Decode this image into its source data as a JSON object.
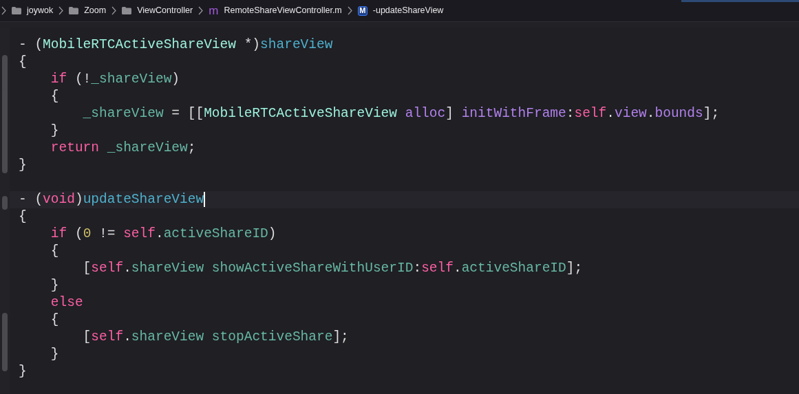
{
  "breadcrumb": [
    {
      "kind": "folder",
      "label": "joywok"
    },
    {
      "kind": "folder",
      "label": "Zoom"
    },
    {
      "kind": "folder",
      "label": "ViewController"
    },
    {
      "kind": "source-file",
      "glyph": "m",
      "label": "RemoteShareViewController.m"
    },
    {
      "kind": "method",
      "glyph": "M",
      "label": "-updateShareView"
    }
  ],
  "lines": [
    {
      "current": false,
      "tokens": [
        {
          "kind": "plain",
          "t": "- ("
        },
        {
          "kind": "type",
          "t": "MobileRTCActiveShareView"
        },
        {
          "kind": "plain",
          "t": " *)"
        },
        {
          "kind": "decl",
          "t": "shareView"
        }
      ]
    },
    {
      "current": false,
      "tokens": [
        {
          "kind": "plain",
          "t": "{"
        }
      ]
    },
    {
      "current": false,
      "tokens": [
        {
          "kind": "keyword",
          "t": "    if"
        },
        {
          "kind": "plain",
          "t": " (!"
        },
        {
          "kind": "ivar",
          "t": "_shareView"
        },
        {
          "kind": "plain",
          "t": ")"
        }
      ]
    },
    {
      "current": false,
      "tokens": [
        {
          "kind": "plain",
          "t": "    {"
        }
      ]
    },
    {
      "current": false,
      "tokens": [
        {
          "kind": "ivar",
          "t": "        _shareView"
        },
        {
          "kind": "plain",
          "t": " = [["
        },
        {
          "kind": "type",
          "t": "MobileRTCActiveShareView"
        },
        {
          "kind": "sdk",
          "t": " alloc"
        },
        {
          "kind": "plain",
          "t": "] "
        },
        {
          "kind": "sdk",
          "t": "initWithFrame"
        },
        {
          "kind": "plain",
          "t": ":"
        },
        {
          "kind": "keyword",
          "t": "self"
        },
        {
          "kind": "plain",
          "t": "."
        },
        {
          "kind": "sdk",
          "t": "view"
        },
        {
          "kind": "plain",
          "t": "."
        },
        {
          "kind": "sdk",
          "t": "bounds"
        },
        {
          "kind": "plain",
          "t": "];"
        }
      ]
    },
    {
      "current": false,
      "tokens": [
        {
          "kind": "plain",
          "t": "    }"
        }
      ]
    },
    {
      "current": false,
      "tokens": [
        {
          "kind": "keyword",
          "t": "    return"
        },
        {
          "kind": "ivar",
          "t": " _shareView"
        },
        {
          "kind": "plain",
          "t": ";"
        }
      ]
    },
    {
      "current": false,
      "tokens": [
        {
          "kind": "plain",
          "t": "}"
        }
      ]
    },
    {
      "current": false
    },
    {
      "current": true,
      "tokens": [
        {
          "kind": "plain",
          "t": "- ("
        },
        {
          "kind": "keyword",
          "t": "void"
        },
        {
          "kind": "plain",
          "t": ")"
        },
        {
          "kind": "decl",
          "t": "updateShareView"
        }
      ]
    },
    {
      "current": false,
      "tokens": [
        {
          "kind": "plain",
          "t": "{"
        }
      ]
    },
    {
      "current": false,
      "tokens": [
        {
          "kind": "keyword",
          "t": "    if"
        },
        {
          "kind": "plain",
          "t": " ("
        },
        {
          "kind": "number",
          "t": "0"
        },
        {
          "kind": "plain",
          "t": " != "
        },
        {
          "kind": "keyword",
          "t": "self"
        },
        {
          "kind": "plain",
          "t": "."
        },
        {
          "kind": "ivar",
          "t": "activeShareID"
        },
        {
          "kind": "plain",
          "t": ")"
        }
      ]
    },
    {
      "current": false,
      "tokens": [
        {
          "kind": "plain",
          "t": "    {"
        }
      ]
    },
    {
      "current": false,
      "tokens": [
        {
          "kind": "plain",
          "t": "        ["
        },
        {
          "kind": "keyword",
          "t": "self"
        },
        {
          "kind": "plain",
          "t": "."
        },
        {
          "kind": "ivar",
          "t": "shareView"
        },
        {
          "kind": "ivar",
          "t": " showActiveShareWithUserID"
        },
        {
          "kind": "plain",
          "t": ":"
        },
        {
          "kind": "keyword",
          "t": "self"
        },
        {
          "kind": "plain",
          "t": "."
        },
        {
          "kind": "ivar",
          "t": "activeShareID"
        },
        {
          "kind": "plain",
          "t": "];"
        }
      ]
    },
    {
      "current": false,
      "tokens": [
        {
          "kind": "plain",
          "t": "    }"
        }
      ]
    },
    {
      "current": false,
      "tokens": [
        {
          "kind": "keyword",
          "t": "    else"
        }
      ]
    },
    {
      "current": false,
      "tokens": [
        {
          "kind": "plain",
          "t": "    {"
        }
      ]
    },
    {
      "current": false,
      "tokens": [
        {
          "kind": "plain",
          "t": "        ["
        },
        {
          "kind": "keyword",
          "t": "self"
        },
        {
          "kind": "plain",
          "t": "."
        },
        {
          "kind": "ivar",
          "t": "shareView"
        },
        {
          "kind": "ivar",
          "t": " stopActiveShare"
        },
        {
          "kind": "plain",
          "t": "];"
        }
      ]
    },
    {
      "current": false,
      "tokens": [
        {
          "kind": "plain",
          "t": "    }"
        }
      ]
    },
    {
      "current": false,
      "tokens": [
        {
          "kind": "plain",
          "t": "}"
        }
      ]
    }
  ]
}
